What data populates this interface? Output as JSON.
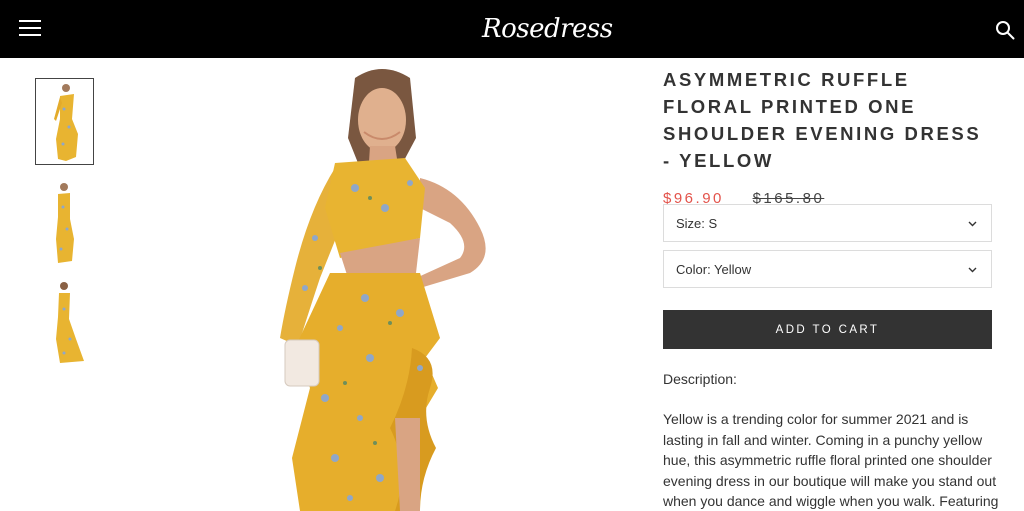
{
  "header": {
    "logo": "Rosedress",
    "menu_icon": "hamburger-menu-icon",
    "search_icon": "search-icon",
    "background": "#000000"
  },
  "thumbnails": [
    {
      "name": "front-view",
      "active": true
    },
    {
      "name": "side-view",
      "active": false
    },
    {
      "name": "back-view",
      "active": false
    }
  ],
  "product": {
    "title": "ASYMMETRIC RUFFLE FLORAL PRINTED ONE SHOULDER EVENING DRESS - YELLOW",
    "price": "$96.90",
    "compare_price": "$165.80",
    "price_color": "#e3534b",
    "size_label": "Size: S",
    "color_label": "Color: Yellow",
    "add_to_cart": "ADD TO CART",
    "description_heading": "Description:",
    "description": "Yellow is a trending color for summer 2021 and is lasting in fall and winter. Coming in a punchy yellow hue, this asymmetric ruffle floral printed one shoulder evening dress in our boutique will make you stand out when you dance and wiggle when you walk. Featuring a"
  }
}
